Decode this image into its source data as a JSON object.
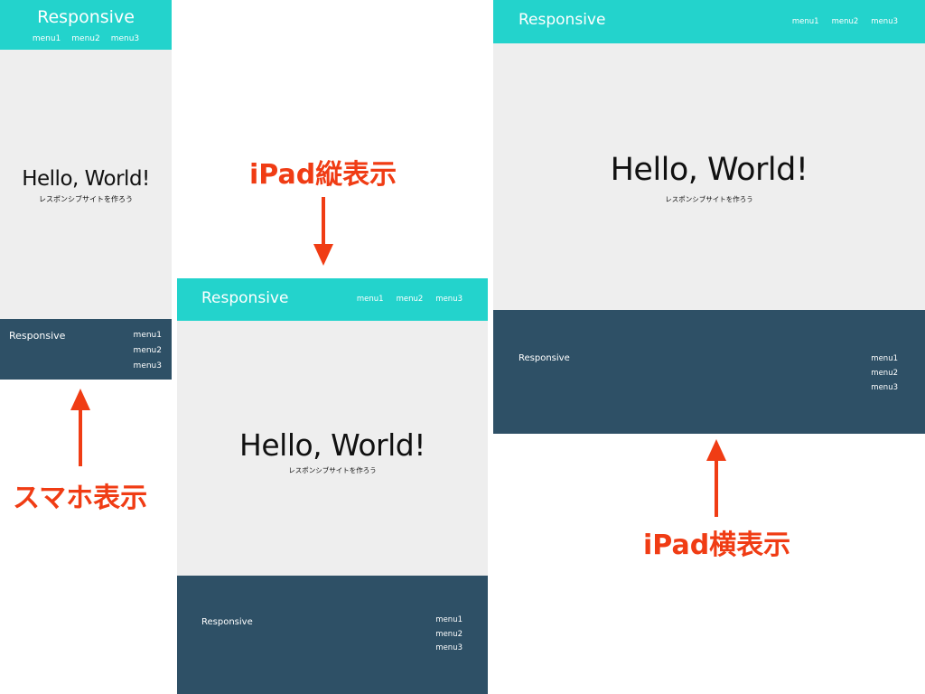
{
  "site": {
    "logo": "Responsive",
    "nav": [
      "menu1",
      "menu2",
      "menu3"
    ],
    "hero_title": "Hello, World!",
    "hero_subtitle": "レスポンシブサイトを作ろう",
    "footer_logo": "Responsive",
    "footer_nav": [
      "menu1",
      "menu2",
      "menu3"
    ]
  },
  "labels": {
    "phone": "スマホ表示",
    "ipad_portrait": "iPad縦表示",
    "ipad_landscape": "iPad横表示"
  },
  "colors": {
    "header": "#23d3cc",
    "hero_bg": "#eeeeee",
    "footer": "#2e5066",
    "label": "#f03c14"
  }
}
